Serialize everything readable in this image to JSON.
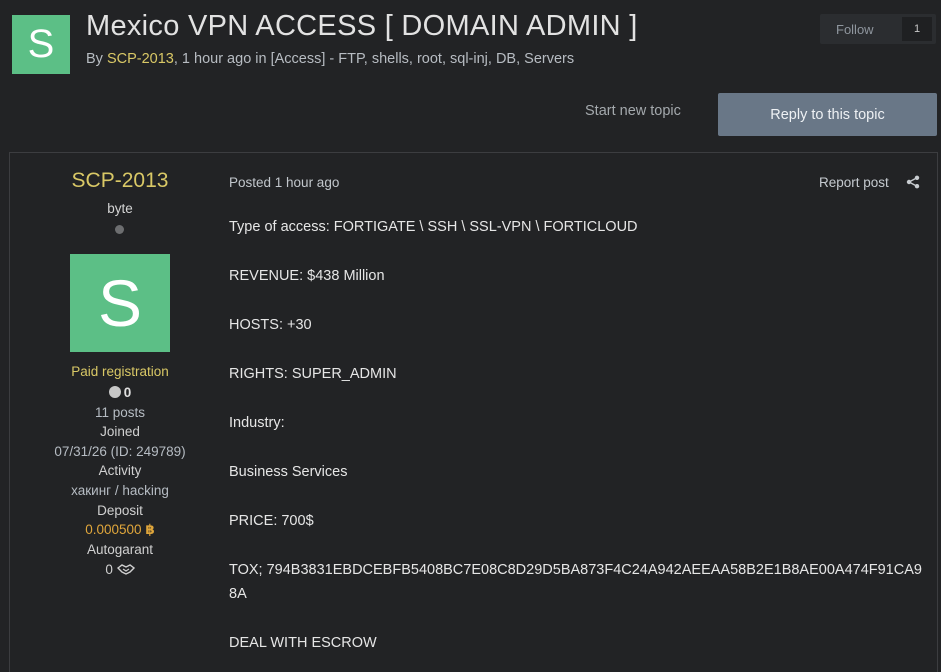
{
  "topic": {
    "avatar_letter": "S",
    "title": "Mexico VPN ACCESS [ DOMAIN ADMIN ]",
    "by_prefix": "By ",
    "author": "SCP-2013",
    "time_suffix": ", 1 hour ago in [Access] - FTP, shells, root, sql-inj, DB, Servers"
  },
  "actions": {
    "follow_label": "Follow",
    "follow_count": "1",
    "start_topic": "Start new topic",
    "reply": "Reply to this topic"
  },
  "author_panel": {
    "name": "SCP-2013",
    "rank": "byte",
    "avatar_letter": "S",
    "group": "Paid registration",
    "reputation": "0",
    "posts": "11 posts",
    "joined_label": "Joined",
    "joined_value": "07/31/26 (ID: 249789)",
    "activity_label": "Activity",
    "activity_value": "хакинг / hacking",
    "deposit_label": "Deposit",
    "deposit_value": "0.000500",
    "deposit_icon": "bitcoin-icon",
    "autogarant_label": "Autogarant",
    "autogarant_value": "0",
    "autogarant_icon": "handshake-icon"
  },
  "post": {
    "posted_label": "Posted ",
    "posted_time": "1 hour ago",
    "report": "Report post",
    "lines": [
      "Type of access: FORTIGATE \\ SSH \\ SSL-VPN \\ FORTICLOUD",
      "REVENUE: $438 Million",
      "HOSTS: +30",
      "RIGHTS: SUPER_ADMIN",
      "Industry:",
      "Business Services",
      "PRICE: 700$",
      "TOX; 794B3831EBDCEBFB5408BC7E08C8D29D5BA873F4C24A942AEEAA58B2E1B8AE00A474F91CA98A",
      "DEAL WITH ESCROW"
    ]
  },
  "colors": {
    "background": "#222325",
    "accent_author": "#d9c866",
    "avatar": "#5cbf86",
    "reply_button": "#697787",
    "deposit": "#e0a63b"
  }
}
